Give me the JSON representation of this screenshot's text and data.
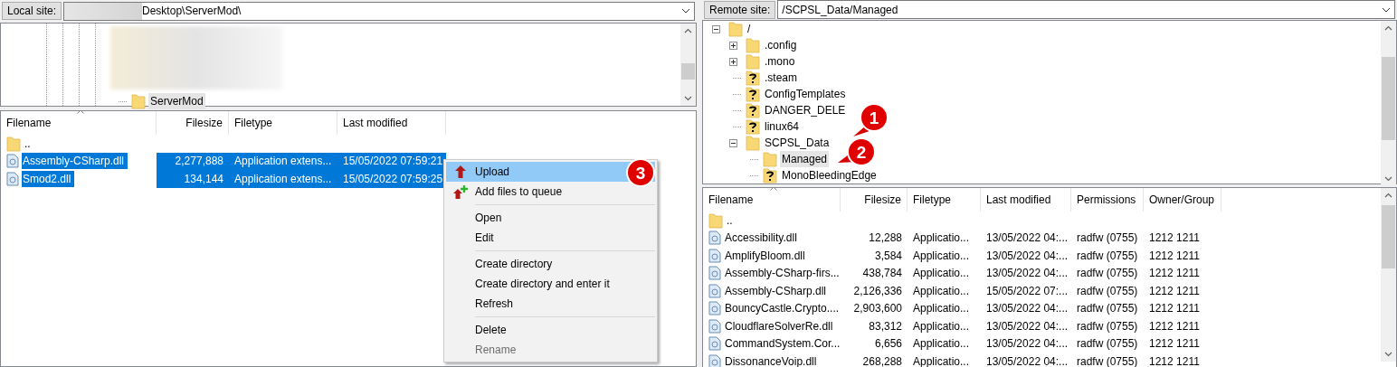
{
  "local": {
    "label": "Local site:",
    "path": "Desktop\\ServerMod\\",
    "tree": [
      {
        "name": "ServerMod",
        "kind": "folder",
        "selected": true
      }
    ],
    "columns": [
      "Filename",
      "Filesize",
      "Filetype",
      "Last modified"
    ],
    "rows": [
      {
        "kind": "folder",
        "cells": [
          "..",
          "",
          "",
          ""
        ],
        "selected": false
      },
      {
        "kind": "file",
        "cells": [
          "Assembly-CSharp.dll",
          "2,277,888",
          "Application extens...",
          "15/05/2022 07:59:21"
        ],
        "selected": true
      },
      {
        "kind": "file",
        "cells": [
          "Smod2.dll",
          "134,144",
          "Application extens...",
          "15/05/2022 07:59:25"
        ],
        "selected": true
      }
    ]
  },
  "remote": {
    "label": "Remote site:",
    "path": "/SCPSL_Data/Managed",
    "tree": [
      {
        "name": "/",
        "kind": "folder",
        "expanded": true,
        "selected": false,
        "children": [
          {
            "name": ".config",
            "kind": "folder",
            "expanded": false,
            "selected": false
          },
          {
            "name": ".mono",
            "kind": "folder",
            "expanded": false,
            "selected": false
          },
          {
            "name": ".steam",
            "kind": "unknown",
            "selected": false
          },
          {
            "name": "ConfigTemplates",
            "kind": "unknown",
            "selected": false
          },
          {
            "name": "DANGER_DELE",
            "kind": "unknown",
            "selected": false
          },
          {
            "name": "linux64",
            "kind": "unknown",
            "selected": false
          },
          {
            "name": "SCPSL_Data",
            "kind": "folder",
            "expanded": true,
            "selected": false,
            "children": [
              {
                "name": "Managed",
                "kind": "folder",
                "selected": true
              },
              {
                "name": "MonoBleedingEdge",
                "kind": "unknown",
                "selected": false
              }
            ]
          }
        ]
      }
    ],
    "columns": [
      "Filename",
      "Filesize",
      "Filetype",
      "Last modified",
      "Permissions",
      "Owner/Group"
    ],
    "rows": [
      {
        "kind": "folder",
        "cells": [
          "..",
          "",
          "",
          "",
          "",
          ""
        ],
        "selected": false
      },
      {
        "kind": "file",
        "cells": [
          "Accessibility.dll",
          "12,288",
          "Applicatio...",
          "13/05/2022 04:...",
          "radfw (0755)",
          "1212 1211"
        ],
        "selected": false
      },
      {
        "kind": "file",
        "cells": [
          "AmplifyBloom.dll",
          "3,584",
          "Applicatio...",
          "13/05/2022 04:...",
          "radfw (0755)",
          "1212 1211"
        ],
        "selected": false
      },
      {
        "kind": "file",
        "cells": [
          "Assembly-CSharp-firs...",
          "438,784",
          "Applicatio...",
          "13/05/2022 04:...",
          "radfw (0755)",
          "1212 1211"
        ],
        "selected": false
      },
      {
        "kind": "file",
        "cells": [
          "Assembly-CSharp.dll",
          "2,126,336",
          "Applicatio...",
          "15/05/2022 07:...",
          "radfw (0755)",
          "1212 1211"
        ],
        "selected": false
      },
      {
        "kind": "file",
        "cells": [
          "BouncyCastle.Crypto....",
          "2,903,600",
          "Applicatio...",
          "13/05/2022 04:...",
          "radfw (0755)",
          "1212 1211"
        ],
        "selected": false
      },
      {
        "kind": "file",
        "cells": [
          "CloudflareSolverRe.dll",
          "83,312",
          "Applicatio...",
          "13/05/2022 04:...",
          "radfw (0755)",
          "1212 1211"
        ],
        "selected": false
      },
      {
        "kind": "file",
        "cells": [
          "CommandSystem.Cor...",
          "6,656",
          "Applicatio...",
          "13/05/2022 04:...",
          "radfw (0755)",
          "1212 1211"
        ],
        "selected": false
      },
      {
        "kind": "file",
        "cells": [
          "DissonanceVoip.dll",
          "268,288",
          "Applicatio...",
          "13/05/2022 04:...",
          "radfw (0755)",
          "1212 1211"
        ],
        "selected": false
      }
    ]
  },
  "context_menu": [
    {
      "kind": "upload",
      "label": "Upload",
      "selected": true,
      "disabled": false
    },
    {
      "kind": "queue",
      "label": "Add files to queue",
      "selected": false,
      "disabled": false
    },
    {
      "kind": "separator"
    },
    {
      "kind": "item",
      "label": "Open",
      "selected": false,
      "disabled": false
    },
    {
      "kind": "item",
      "label": "Edit",
      "selected": false,
      "disabled": false
    },
    {
      "kind": "separator"
    },
    {
      "kind": "item",
      "label": "Create directory",
      "selected": false,
      "disabled": false
    },
    {
      "kind": "item",
      "label": "Create directory and enter it",
      "selected": false,
      "disabled": false
    },
    {
      "kind": "item",
      "label": "Refresh",
      "selected": false,
      "disabled": false
    },
    {
      "kind": "separator"
    },
    {
      "kind": "item",
      "label": "Delete",
      "selected": false,
      "disabled": false
    },
    {
      "kind": "item",
      "label": "Rename",
      "selected": false,
      "disabled": true
    }
  ],
  "callouts": [
    "1",
    "2",
    "3"
  ]
}
